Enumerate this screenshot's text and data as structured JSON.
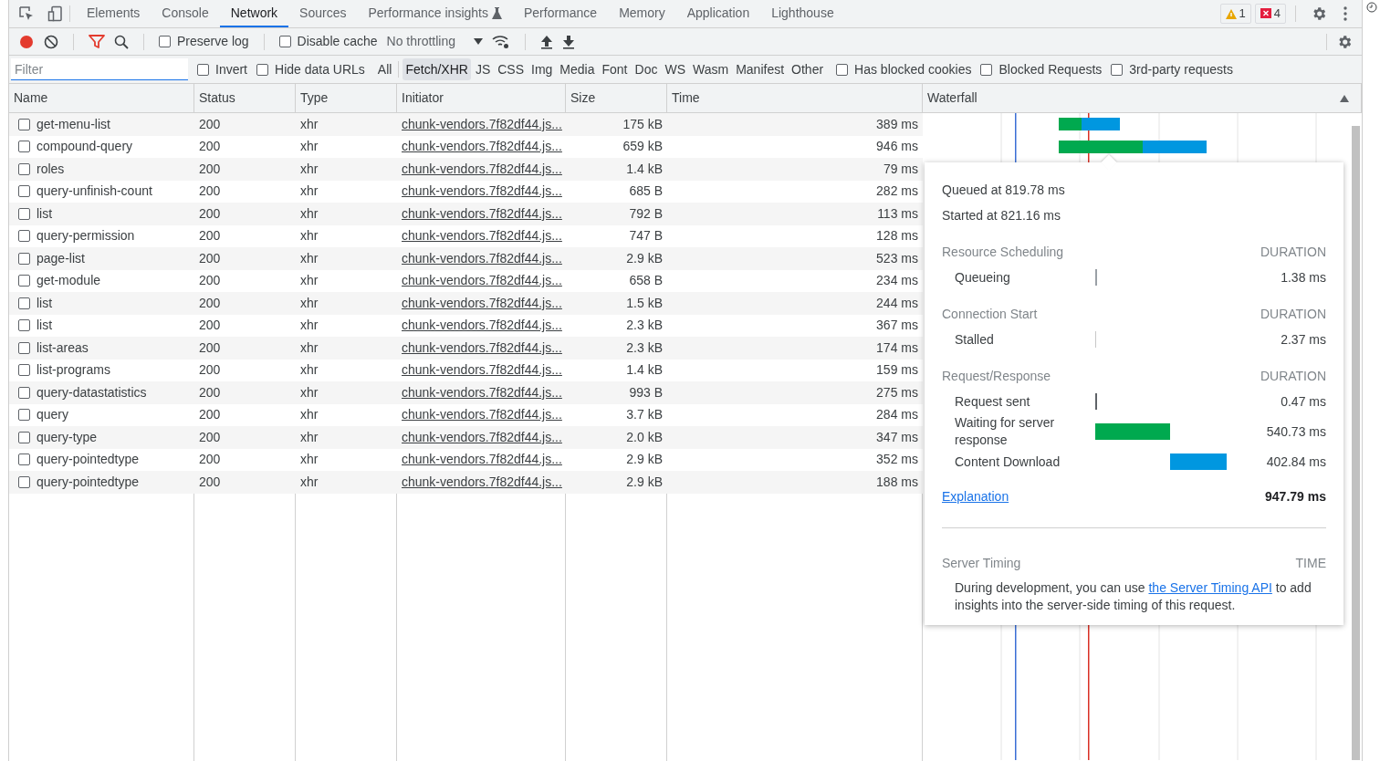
{
  "tabs": [
    {
      "label": "Elements",
      "selected": false,
      "kind": "plain"
    },
    {
      "label": "Console",
      "selected": false,
      "kind": "plain"
    },
    {
      "label": "Network",
      "selected": true,
      "kind": "plain"
    },
    {
      "label": "Sources",
      "selected": false,
      "kind": "plain"
    },
    {
      "label": "Performance insights",
      "selected": false,
      "kind": "experiment"
    },
    {
      "label": "Performance",
      "selected": false,
      "kind": "plain"
    },
    {
      "label": "Memory",
      "selected": false,
      "kind": "plain"
    },
    {
      "label": "Application",
      "selected": false,
      "kind": "plain"
    },
    {
      "label": "Lighthouse",
      "selected": false,
      "kind": "plain"
    }
  ],
  "issues": {
    "warnings": "1",
    "errors": "4"
  },
  "toolbar": {
    "recording": true,
    "preserve_log": {
      "label": "Preserve log",
      "checked": false
    },
    "disable_cache": {
      "label": "Disable cache",
      "checked": false
    },
    "throttling": "No throttling"
  },
  "filter": {
    "placeholder": "Filter",
    "invert": {
      "label": "Invert",
      "checked": false
    },
    "hide_data_urls": {
      "label": "Hide data URLs",
      "checked": false
    },
    "types": [
      {
        "label": "All",
        "selected": false
      },
      {
        "label": "Fetch/XHR",
        "selected": true
      },
      {
        "label": "JS",
        "selected": false
      },
      {
        "label": "CSS",
        "selected": false
      },
      {
        "label": "Img",
        "selected": false
      },
      {
        "label": "Media",
        "selected": false
      },
      {
        "label": "Font",
        "selected": false
      },
      {
        "label": "Doc",
        "selected": false
      },
      {
        "label": "WS",
        "selected": false
      },
      {
        "label": "Wasm",
        "selected": false
      },
      {
        "label": "Manifest",
        "selected": false
      },
      {
        "label": "Other",
        "selected": false
      }
    ],
    "options": [
      {
        "label": "Has blocked cookies",
        "checked": false
      },
      {
        "label": "Blocked Requests",
        "checked": false
      },
      {
        "label": "3rd-party requests",
        "checked": false
      }
    ]
  },
  "table": {
    "columns": [
      "Name",
      "Status",
      "Type",
      "Initiator",
      "Size",
      "Time",
      "Waterfall"
    ],
    "rows": [
      {
        "name": "get-menu-list",
        "status": "200",
        "type": "xhr",
        "initiator": "chunk-vendors.7f82df44.js...",
        "size": "175 kB",
        "time": "389 ms",
        "checked": false
      },
      {
        "name": "compound-query",
        "status": "200",
        "type": "xhr",
        "initiator": "chunk-vendors.7f82df44.js...",
        "size": "659 kB",
        "time": "946 ms",
        "checked": false
      },
      {
        "name": "roles",
        "status": "200",
        "type": "xhr",
        "initiator": "chunk-vendors.7f82df44.js...",
        "size": "1.4 kB",
        "time": "79 ms",
        "checked": false
      },
      {
        "name": "query-unfinish-count",
        "status": "200",
        "type": "xhr",
        "initiator": "chunk-vendors.7f82df44.js...",
        "size": "685 B",
        "time": "282 ms",
        "checked": false
      },
      {
        "name": "list",
        "status": "200",
        "type": "xhr",
        "initiator": "chunk-vendors.7f82df44.js...",
        "size": "792 B",
        "time": "113 ms",
        "checked": false
      },
      {
        "name": "query-permission",
        "status": "200",
        "type": "xhr",
        "initiator": "chunk-vendors.7f82df44.js...",
        "size": "747 B",
        "time": "128 ms",
        "checked": false
      },
      {
        "name": "page-list",
        "status": "200",
        "type": "xhr",
        "initiator": "chunk-vendors.7f82df44.js...",
        "size": "2.9 kB",
        "time": "523 ms",
        "checked": false
      },
      {
        "name": "get-module",
        "status": "200",
        "type": "xhr",
        "initiator": "chunk-vendors.7f82df44.js...",
        "size": "658 B",
        "time": "234 ms",
        "checked": false
      },
      {
        "name": "list",
        "status": "200",
        "type": "xhr",
        "initiator": "chunk-vendors.7f82df44.js...",
        "size": "1.5 kB",
        "time": "244 ms",
        "checked": false
      },
      {
        "name": "list",
        "status": "200",
        "type": "xhr",
        "initiator": "chunk-vendors.7f82df44.js...",
        "size": "2.3 kB",
        "time": "367 ms",
        "checked": false
      },
      {
        "name": "list-areas",
        "status": "200",
        "type": "xhr",
        "initiator": "chunk-vendors.7f82df44.js...",
        "size": "2.3 kB",
        "time": "174 ms",
        "checked": false
      },
      {
        "name": "list-programs",
        "status": "200",
        "type": "xhr",
        "initiator": "chunk-vendors.7f82df44.js...",
        "size": "1.4 kB",
        "time": "159 ms",
        "checked": false
      },
      {
        "name": "query-datastatistics",
        "status": "200",
        "type": "xhr",
        "initiator": "chunk-vendors.7f82df44.js...",
        "size": "993 B",
        "time": "275 ms",
        "checked": false
      },
      {
        "name": "query",
        "status": "200",
        "type": "xhr",
        "initiator": "chunk-vendors.7f82df44.js...",
        "size": "3.7 kB",
        "time": "284 ms",
        "checked": false
      },
      {
        "name": "query-type",
        "status": "200",
        "type": "xhr",
        "initiator": "chunk-vendors.7f82df44.js...",
        "size": "2.0 kB",
        "time": "347 ms",
        "checked": false
      },
      {
        "name": "query-pointedtype",
        "status": "200",
        "type": "xhr",
        "initiator": "chunk-vendors.7f82df44.js...",
        "size": "2.9 kB",
        "time": "352 ms",
        "checked": false
      },
      {
        "name": "query-pointedtype",
        "status": "200",
        "type": "xhr",
        "initiator": "chunk-vendors.7f82df44.js...",
        "size": "2.9 kB",
        "time": "188 ms",
        "checked": false
      }
    ]
  },
  "timing": {
    "queued": "Queued at 819.78 ms",
    "started": "Started at 821.16 ms",
    "sections": [
      {
        "title": "Resource Scheduling",
        "unit": "DURATION",
        "phases": [
          {
            "label": "Queueing",
            "value": "1.38 ms",
            "kind": "queueing"
          }
        ]
      },
      {
        "title": "Connection Start",
        "unit": "DURATION",
        "phases": [
          {
            "label": "Stalled",
            "value": "2.37 ms",
            "kind": "stalled"
          }
        ]
      },
      {
        "title": "Request/Response",
        "unit": "DURATION",
        "phases": [
          {
            "label": "Request sent",
            "value": "0.47 ms",
            "kind": "sent"
          },
          {
            "label": "Waiting for server response",
            "value": "540.73 ms",
            "kind": "waiting"
          },
          {
            "label": "Content Download",
            "value": "402.84 ms",
            "kind": "download"
          }
        ]
      }
    ],
    "explanation": "Explanation",
    "total": "947.79 ms",
    "server_timing": {
      "title": "Server Timing",
      "unit": "TIME",
      "before": "During development, you can use ",
      "link": "the Server Timing API",
      "after": " to add insights into the server-side timing of this request."
    }
  }
}
